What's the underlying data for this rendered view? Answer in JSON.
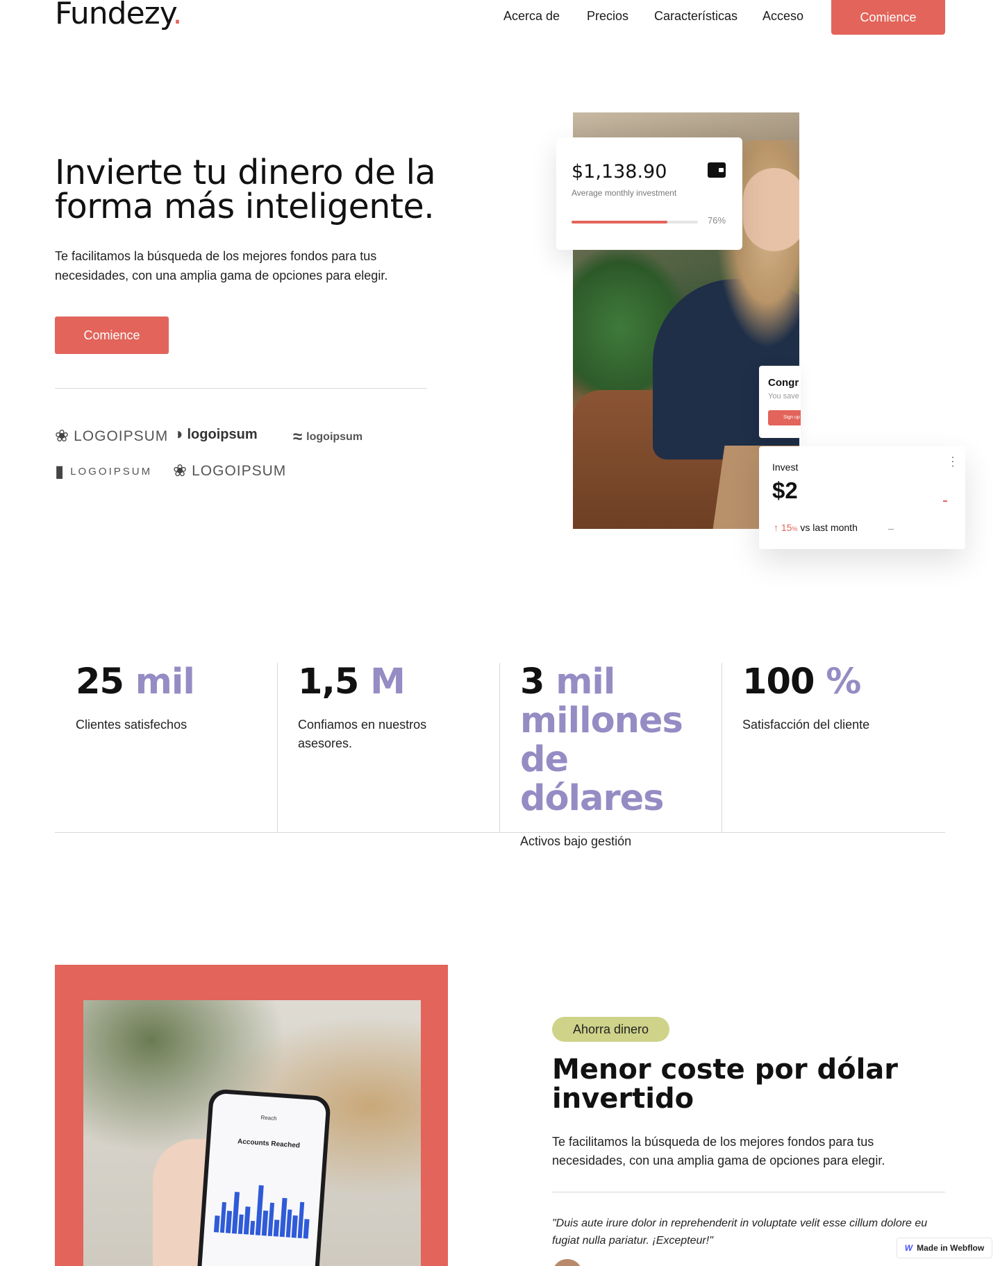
{
  "header": {
    "logo": "Fundezy",
    "logo_dot": ".",
    "nav": [
      "Acerca de",
      "Precios",
      "Características",
      "Acceso"
    ],
    "cta": "Comience"
  },
  "hero": {
    "title": "Invierte tu dinero de la forma más inteligente.",
    "text": "Te facilitamos la búsqueda de los mejores fondos para tus necesidades, con una amplia gama de opciones para elegir.",
    "cta": "Comience",
    "logos": [
      "LOGOIPSUM",
      "logoipsum",
      "logoipsum",
      "LOGOIPSUM",
      "LOGOIPSUM"
    ]
  },
  "cards": {
    "investment": {
      "amount": "$1,138.90",
      "label": "Average monthly investment",
      "progress": 0.76,
      "progress_label": "76%"
    },
    "congrats": {
      "title": "Congr",
      "subtitle": "You save",
      "button": "Sign up"
    },
    "invested": {
      "title": "Invest",
      "value": "$2",
      "trend_value": "15",
      "trend_unit": "%",
      "trend_label": "vs last month"
    }
  },
  "stats": [
    {
      "number": "25",
      "accent": "mil",
      "label": "Clientes satisfechos"
    },
    {
      "number": "1,5",
      "accent": "M",
      "label": "Confiamos en nuestros asesores."
    },
    {
      "number": "3",
      "accent": "mil millones de dólares",
      "label": "Activos bajo gestión"
    },
    {
      "number": "100",
      "accent": "%",
      "label": "Satisfacción del cliente"
    }
  ],
  "feature": {
    "badge": "Ahorra dinero",
    "title": "Menor coste por dólar invertido",
    "text": "Te facilitamos la búsqueda de los mejores fondos para tus necesidades, con una amplia gama de opciones para elegir.",
    "quote": "\"Duis aute irure dolor in reprehenderit in voluptate velit esse cillum dolore eu fugiat nulla pariatur. ¡Excepteur!\"",
    "phone_title": "Reach",
    "phone_chart": "Accounts Reached"
  },
  "badge": {
    "text": "Made in Webflow"
  },
  "colors": {
    "accent": "#e2645a",
    "stat_accent": "#958cc4",
    "badge": "#cfd389"
  }
}
